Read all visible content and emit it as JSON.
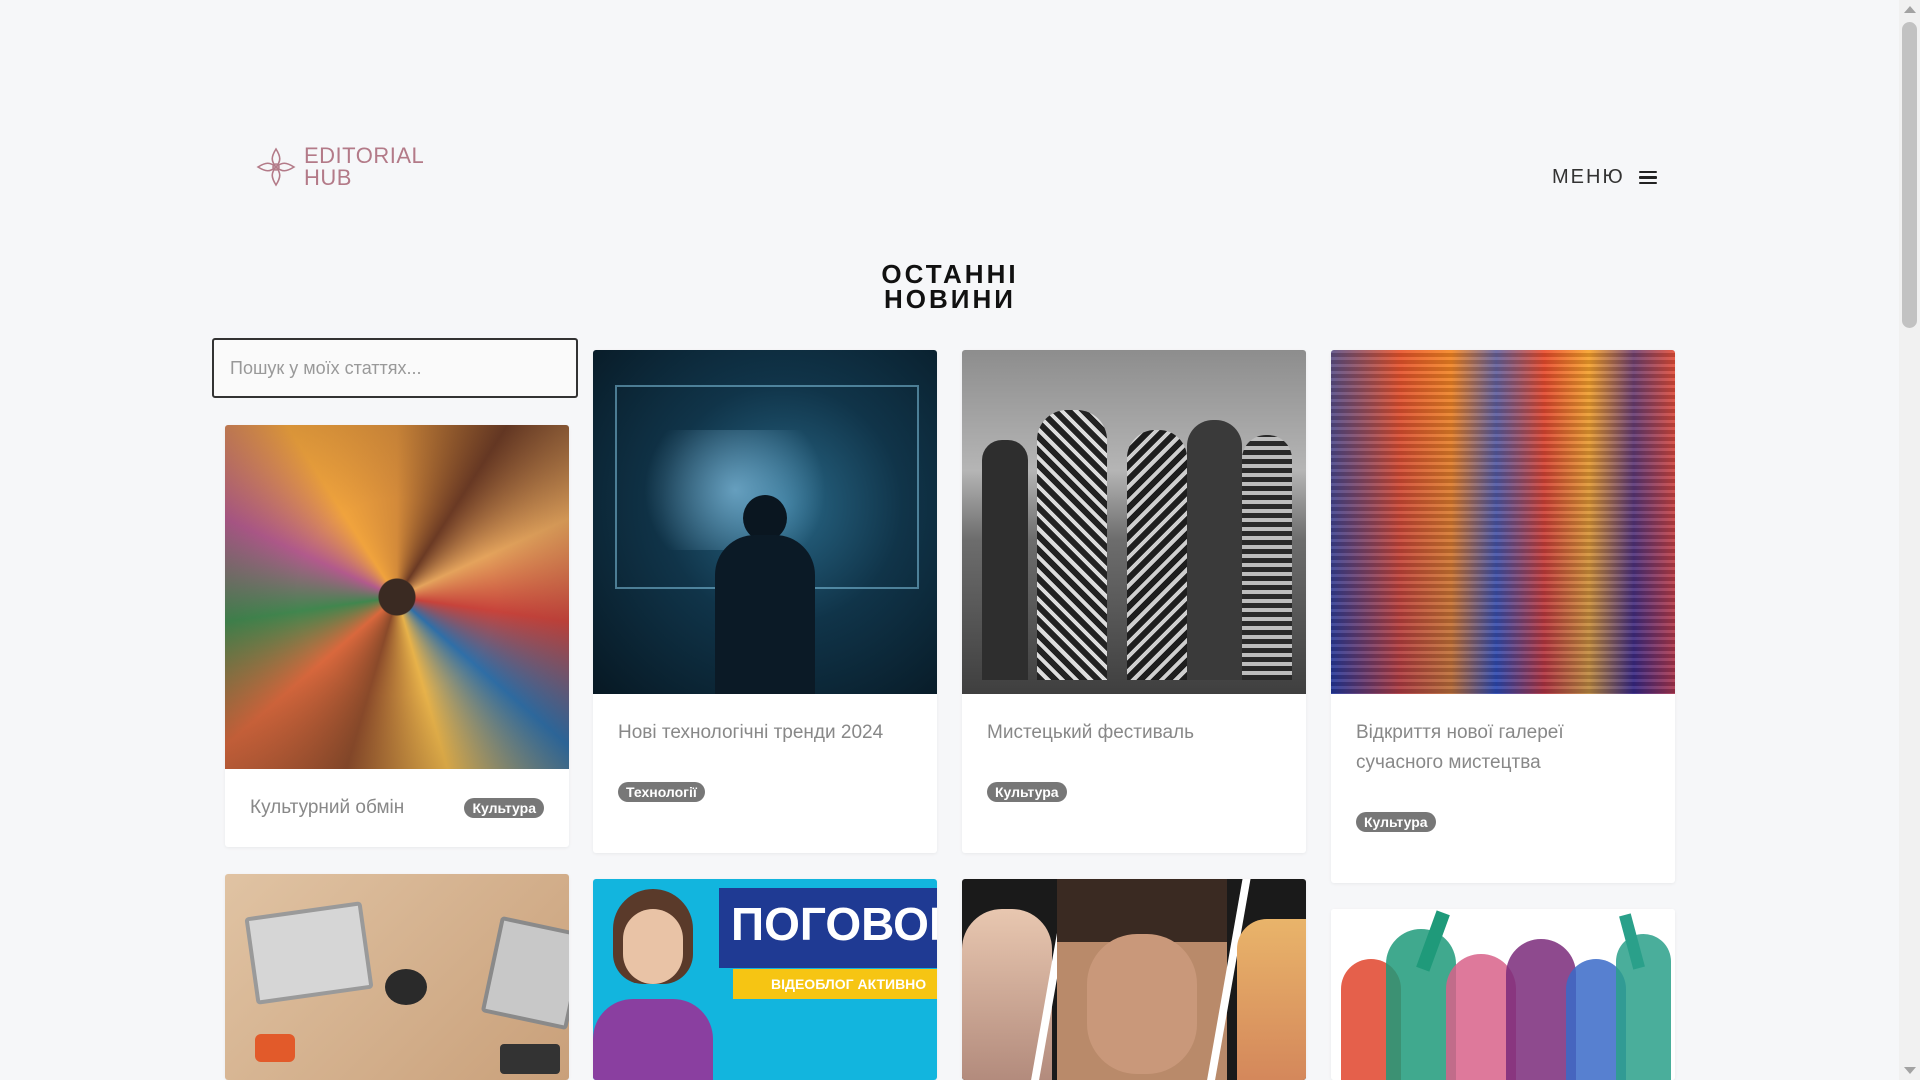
{
  "brand": {
    "line1": "EDITORIAL",
    "line2": "HUB",
    "color": "#b37a88"
  },
  "header": {
    "menu_label": "МЕНЮ",
    "menu_icon": "hamburger-icon"
  },
  "page_title_line1": "ОСТАННІ",
  "page_title_line2": "НОВИНИ",
  "search": {
    "placeholder": "Пошук у моїх статтях...",
    "value": ""
  },
  "articles": [
    {
      "title": "Культурний обмін",
      "category": "Культура"
    },
    {
      "title": "Нові технологічні тренди 2024",
      "category": "Технології"
    },
    {
      "title": "Мистецький фестиваль",
      "category": "Культура"
    },
    {
      "title": "Відкриття нової галереї сучасного мистецтва",
      "category": "Культура"
    }
  ],
  "banner": {
    "headline": "ПОГОВОР",
    "subline": "ВІДЕОБЛОГ АКТИВНО"
  },
  "colors": {
    "badge": "#777777",
    "accent_blue": "#12b5de",
    "banner_navy": "#1f3a93",
    "banner_yellow": "#f6c513"
  }
}
